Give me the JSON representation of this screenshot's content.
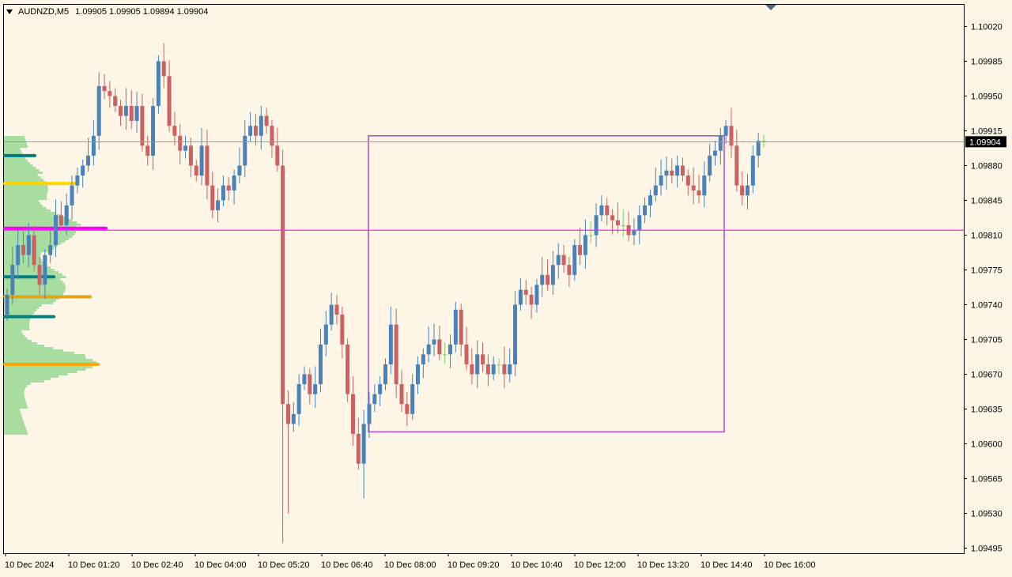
{
  "header": {
    "symbol": "AUDNZD,M5",
    "ohlc": "1.09905 1.09905 1.09894 1.09904"
  },
  "colors": {
    "background": "#fdf5e6",
    "bull": "#4a82b8",
    "bear": "#cd6161",
    "doji": "#7ccf5e",
    "grid_line": "#000000",
    "bid_line": "#8a9ab0",
    "level_line": "#ff24ff",
    "range_box": "#a64bd2",
    "volume_profile": "#a8dda0"
  },
  "chart_data": {
    "type": "candlestick",
    "symbol": "AUDNZD",
    "timeframe": "M5",
    "current_price": "1.09904",
    "y_range": [
      1.0948,
      1.1005
    ],
    "y_ticks": [
      "1.10020",
      "1.09985",
      "1.09950",
      "1.09915",
      "1.09880",
      "1.09845",
      "1.09810",
      "1.09775",
      "1.09740",
      "1.09705",
      "1.09670",
      "1.09635",
      "1.09600",
      "1.09565",
      "1.09530",
      "1.09495"
    ],
    "x_ticks": [
      "10 Dec 2024",
      "10 Dec 01:20",
      "10 Dec 02:40",
      "10 Dec 04:00",
      "10 Dec 05:20",
      "10 Dec 06:40",
      "10 Dec 08:00",
      "10 Dec 09:20",
      "10 Dec 10:40",
      "10 Dec 12:00",
      "10 Dec 13:20",
      "10 Dec 14:40",
      "10 Dec 16:00"
    ],
    "horizontal_level": 1.09815,
    "range_box": {
      "from": "10 Dec 07:00",
      "to": "10 Dec 14:30",
      "high": 1.0991,
      "low": 1.09612
    },
    "volume_profile_levels": [
      {
        "price": 1.0989,
        "color": "#008080"
      },
      {
        "price": 1.09862,
        "color": "#ffd700"
      },
      {
        "price": 1.09817,
        "color": "#ff00ff"
      },
      {
        "price": 1.09768,
        "color": "#008080"
      },
      {
        "price": 1.09748,
        "color": "#daa520"
      },
      {
        "price": 1.09728,
        "color": "#008080"
      },
      {
        "price": 1.0968,
        "color": "#ffa500"
      }
    ],
    "closes": [
      1.0975,
      1.0978,
      1.098,
      1.0979,
      1.0981,
      1.0978,
      1.0976,
      1.0979,
      1.098,
      1.0983,
      1.0982,
      1.0984,
      1.0986,
      1.0987,
      1.0988,
      1.0989,
      1.0991,
      1.0996,
      1.09955,
      1.0995,
      1.0994,
      1.0993,
      1.0994,
      1.09925,
      1.0994,
      1.099,
      1.0989,
      1.0994,
      1.09985,
      1.0997,
      1.0992,
      1.0991,
      1.09895,
      1.099,
      1.0988,
      1.0987,
      1.099,
      1.0986,
      1.09835,
      1.09845,
      1.0986,
      1.09855,
      1.0987,
      1.0988,
      1.0991,
      1.0992,
      1.0991,
      1.0993,
      1.0992,
      1.099,
      1.0988,
      1.0964,
      1.0962,
      1.0963,
      1.0966,
      1.0967,
      1.0965,
      1.0966,
      1.097,
      1.0972,
      1.0974,
      1.0973,
      1.097,
      1.0965,
      1.0961,
      1.0958,
      1.0962,
      1.0964,
      1.0965,
      1.0966,
      1.0968,
      1.0972,
      1.0966,
      1.0964,
      1.0963,
      1.0966,
      1.0968,
      1.0969,
      1.097,
      1.09705,
      1.0969,
      1.0969,
      1.097,
      1.09735,
      1.097,
      1.0968,
      1.0967,
      1.0969,
      1.0968,
      1.0967,
      1.0968,
      1.0968,
      1.0967,
      1.0968,
      1.0974,
      1.09755,
      1.0975,
      1.0974,
      1.0976,
      1.0977,
      1.0976,
      1.0978,
      1.0979,
      1.0978,
      1.0977,
      1.098,
      1.0979,
      1.0981,
      1.0981,
      1.0983,
      1.0984,
      1.0983,
      1.09825,
      1.0982,
      1.0982,
      1.0981,
      1.09815,
      1.0983,
      1.0984,
      1.0985,
      1.0986,
      1.0987,
      1.09875,
      1.0987,
      1.0988,
      1.0987,
      1.0986,
      1.09855,
      1.0985,
      1.0987,
      1.0989,
      1.09895,
      1.0991,
      1.0992,
      1.099,
      1.0986,
      1.0985,
      1.0986,
      1.0989,
      1.09905,
      1.09904
    ],
    "highlighted_price": "1.09904"
  }
}
